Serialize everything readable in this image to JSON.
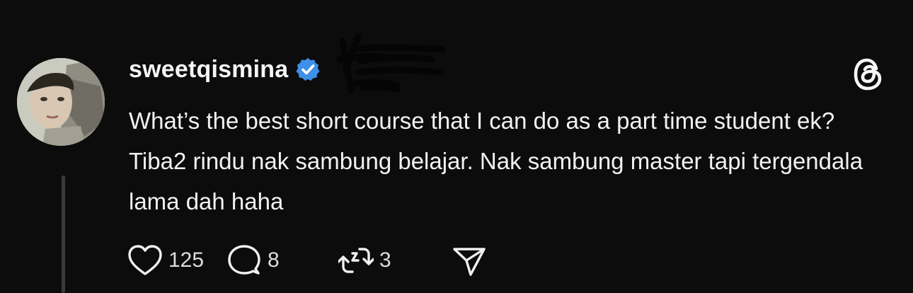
{
  "post": {
    "username": "sweetqismina",
    "verified_icon": "verified-badge-icon",
    "text": "What’s the best short course that I can do as a part time student ek? Tiba2 rindu nak sambung belajar. Nak sambung master tapi tergendala lama dah haha",
    "stats": {
      "likes": "125",
      "replies": "8",
      "reposts": "3"
    }
  },
  "icons": {
    "like": "heart-icon",
    "reply": "comment-bubble-icon",
    "repost": "repost-icon",
    "share": "send-icon",
    "brand": "threads-logo-icon"
  },
  "colors": {
    "background": "#0c0c0c",
    "text": "#f2f2f2",
    "verified": "#3d8fe8"
  }
}
